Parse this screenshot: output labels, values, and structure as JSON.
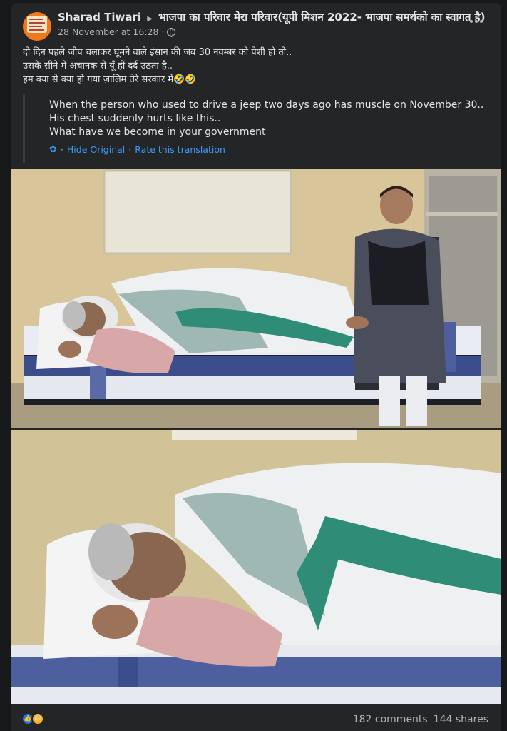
{
  "post": {
    "author": "Sharad Tiwari",
    "group": "भाजपा का परिवार मेरा परिवार(यूपी मिशन 2022- भाजपा समर्थको का स्वागत है)",
    "timestamp": "28 November at 16:28",
    "privacy_icon": "globe-icon",
    "text_lines": [
      "दो दिन पहले जीप चलाकर घूमने वाले इंसान की जब 30 नवम्बर को पेशी हो तो..",
      "उसके सीने में अचानक से यूँ हीं दर्द उठता है..",
      "हम क्या से क्या हो गया ज़ालिम तेरे सरकार में🤣🤣"
    ]
  },
  "translation": {
    "lines": [
      "When the person who used to drive a jeep two days ago has muscle on November 30..",
      "His chest suddenly hurts like this..",
      "What have we become in your government"
    ],
    "hide_label": "Hide Original",
    "rate_label": "Rate this translation",
    "separator": "·"
  },
  "footer": {
    "comments": "182 comments",
    "shares": "144 shares",
    "reaction_icons": [
      "like-icon",
      "haha-icon"
    ]
  },
  "colors": {
    "background": "#18191a",
    "card": "#242526",
    "link": "#3a9bfd",
    "secondary_text": "#b0b3b8"
  }
}
